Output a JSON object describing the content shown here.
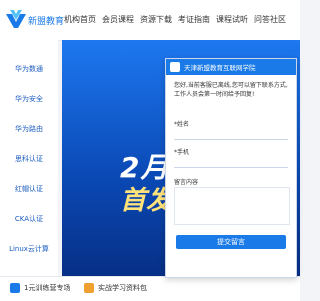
{
  "brand": {
    "name": "新盟教育",
    "accent": "#1a7ae8"
  },
  "nav": {
    "items": [
      "机构首页",
      "会员课程",
      "资源下载",
      "考证指南",
      "课程试听",
      "问答社区"
    ]
  },
  "sidebar": {
    "items": [
      "华为数通",
      "华为安全",
      "华为路由",
      "思科认证",
      "红帽认证",
      "CKA认证",
      "Linux云计算"
    ]
  },
  "hero": {
    "headline": "2月",
    "subheadline": "首发"
  },
  "bottom": {
    "items": [
      "1元训练营专场",
      "实战学习资料包"
    ]
  },
  "chat": {
    "title": "天津新盟教育互联网学院",
    "message": "您好,当前客服已离线,您可以留下联系方式,工作人员会第一时间给予回复!",
    "name_label": "*姓名",
    "phone_label": "*手机",
    "note_label": "留言内容",
    "submit_label": "提交留言"
  }
}
